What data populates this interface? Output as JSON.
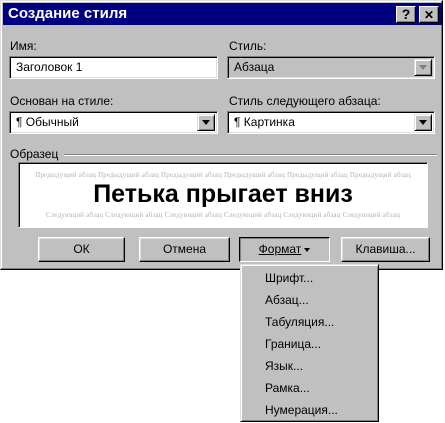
{
  "window": {
    "title": "Создание стиля",
    "help_glyph": "?",
    "close_glyph": "✕"
  },
  "form": {
    "name_label": "Имя:",
    "name_value": "Заголовок 1",
    "style_label": "Стиль:",
    "style_value": "Абзаца",
    "based_on_label": "Основан на стиле:",
    "based_on_value": "¶ Обычный",
    "next_style_label": "Стиль следующего абзаца:",
    "next_style_value": "¶ Картинка"
  },
  "preview": {
    "group_label": "Образец",
    "prev_text": "Предыдущий абзац Предыдущий абзац Предыдущий абзац Предыдущий абзац Предыдущий абзац Предыдущий абзац",
    "sample_text": "Петька прыгает вниз",
    "next_text": "Следующий абзац Следующий абзац Следующий абзац Следующий абзац Следующий абзац Следующий абзац"
  },
  "buttons": {
    "ok": "ОК",
    "cancel": "Отмена",
    "format": "Формат",
    "shortcut": "Клавиша..."
  },
  "format_menu": {
    "items": [
      "Шрифт...",
      "Абзац...",
      "Табуляция...",
      "Граница...",
      "Язык...",
      "Рамка...",
      "Нумерация..."
    ]
  },
  "colors": {
    "titlebar": "#000080",
    "face": "#c0c0c0"
  }
}
